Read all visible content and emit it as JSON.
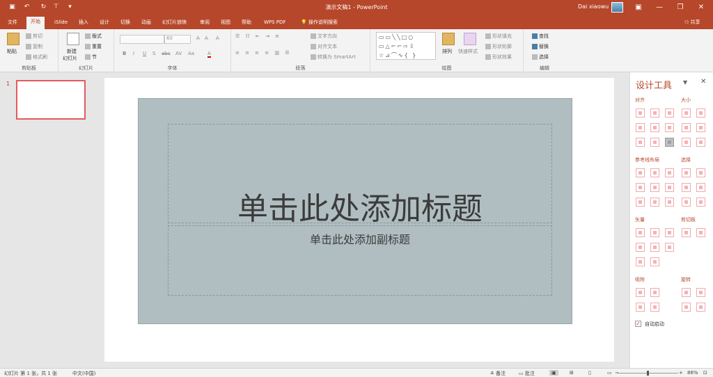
{
  "window": {
    "doc_title": "演示文稿1  -  PowerPoint",
    "user_name": "Dai xiaowu",
    "quick_access": [
      "save-icon",
      "undo-icon",
      "redo-icon",
      "format-painter-icon",
      "customize-icon"
    ],
    "controls": {
      "ribbon_display": "▣",
      "minimize": "—",
      "maximize": "❐",
      "close": "✕"
    }
  },
  "tabs": [
    {
      "label": "文件",
      "active": false
    },
    {
      "label": "开始",
      "active": true
    },
    {
      "label": "iSlide",
      "active": false
    },
    {
      "label": "插入",
      "active": false
    },
    {
      "label": "设计",
      "active": false
    },
    {
      "label": "切换",
      "active": false
    },
    {
      "label": "动画",
      "active": false
    },
    {
      "label": "幻灯片放映",
      "active": false
    },
    {
      "label": "审阅",
      "active": false
    },
    {
      "label": "视图",
      "active": false
    },
    {
      "label": "帮助",
      "active": false
    },
    {
      "label": "WPS PDF",
      "active": false
    }
  ],
  "tell_me": "操作说明搜索",
  "share": "共享",
  "ribbon": {
    "clipboard": {
      "label": "剪贴板",
      "paste": "粘贴",
      "cut": "剪切",
      "copy": "复制",
      "format_painter": "格式刷"
    },
    "slides": {
      "label": "幻灯片",
      "new_slide": "新建",
      "new_slide2": "幻灯片",
      "layout": "版式",
      "reset": "重置",
      "section": "节"
    },
    "font": {
      "label": "字体",
      "size_value": "60",
      "bold": "B",
      "italic": "I",
      "underline": "U",
      "shadow": "S",
      "strike": "abc",
      "spacing": "AV",
      "case": "Aa",
      "grow": "A",
      "shrink": "A",
      "clear": "A",
      "color": "A"
    },
    "paragraph": {
      "label": "段落",
      "text_direction": "文字方向",
      "align_text": "对齐文本",
      "smartart": "转换为 SmartArt"
    },
    "drawing": {
      "label": "绘图",
      "arrange": "排列",
      "quick_styles": "快速样式",
      "shape_fill": "形状填充",
      "shape_outline": "形状轮廓",
      "shape_effects": "形状效果"
    },
    "editing": {
      "label": "编辑",
      "find": "查找",
      "replace": "替换",
      "select": "选择"
    }
  },
  "thumbnail": {
    "number": "1"
  },
  "slide": {
    "title_placeholder": "单击此处添加标题",
    "subtitle_placeholder": "单击此处添加副标题"
  },
  "design_pane": {
    "title": "设计工具",
    "sections": {
      "align": "对齐",
      "size": "大小",
      "guides": "参考线布局",
      "select": "选择",
      "vector": "矢量",
      "clipboard": "剪切板",
      "snap": "吸附",
      "rotate": "旋转"
    },
    "auto_start": "自动启动"
  },
  "status": {
    "slide_info": "幻灯片 第 1 张，共 1 张",
    "language": "中文(中国)",
    "notes": "备注",
    "comments": "批注",
    "zoom": "86%"
  }
}
